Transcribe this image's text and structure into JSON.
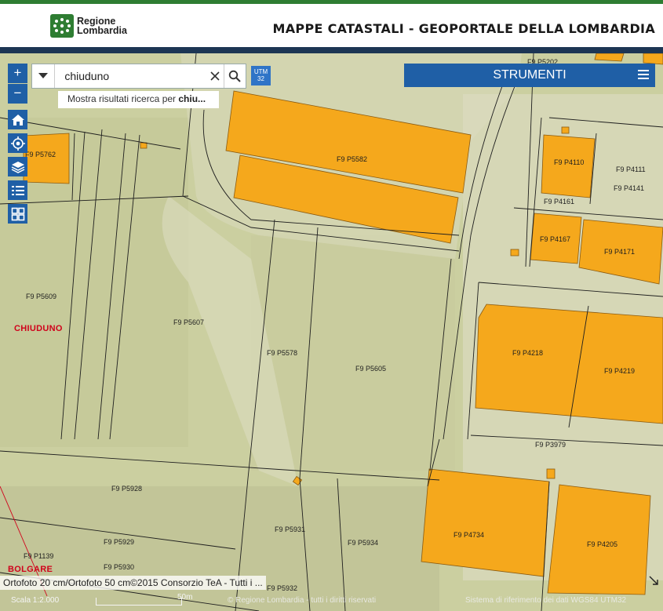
{
  "header": {
    "logo_line1": "Regione",
    "logo_line2": "Lombardia",
    "title": "MAPPE CATASTALI - GEOPORTALE DELLA LOMBARDIA"
  },
  "search": {
    "value": "chiuduno",
    "suggestion_prefix": "Mostra risultati ricerca per ",
    "suggestion_term": "chiu..."
  },
  "controls": {
    "zoom_in": "+",
    "zoom_out": "−",
    "utm_line1": "UTM",
    "utm_line2": "32",
    "tools_label": "STRUMENTI"
  },
  "map": {
    "towns": [
      "CHIUDUNO",
      "BOLGARE"
    ],
    "parcels": [
      "F9 P5762",
      "F9 P5582",
      "F9 P5202",
      "F9 P4110",
      "F9 P4111",
      "F9 P4141",
      "F9 P4161",
      "F9 P4167",
      "F9 P4171",
      "F9 P5609",
      "F9 P5607",
      "F9 P5578",
      "F9 P5605",
      "F9 P4218",
      "F9 P4219",
      "F9 P3979",
      "F9 P5928",
      "F9 P4734",
      "F9 P4205",
      "F9 P5931",
      "F9 P5934",
      "F9 P5929",
      "F9 P5930",
      "F9 P5932",
      "F9 P1139"
    ]
  },
  "footer": {
    "attribution": "Ortofoto 20 cm/Ortofoto 50 cm©2015 Consorzio TeA - Tutti i ...",
    "scale": "Scala 1:2.000",
    "scale_bar": "50m",
    "copyright": "© Regione Lombardia - tutti i diritti riservati",
    "ref_system": "Sistema di riferimento dei dati WGS84 UTM32"
  },
  "colors": {
    "building": "#f5a81c",
    "accent": "#1f5fa6",
    "town_label": "#d0021b"
  }
}
